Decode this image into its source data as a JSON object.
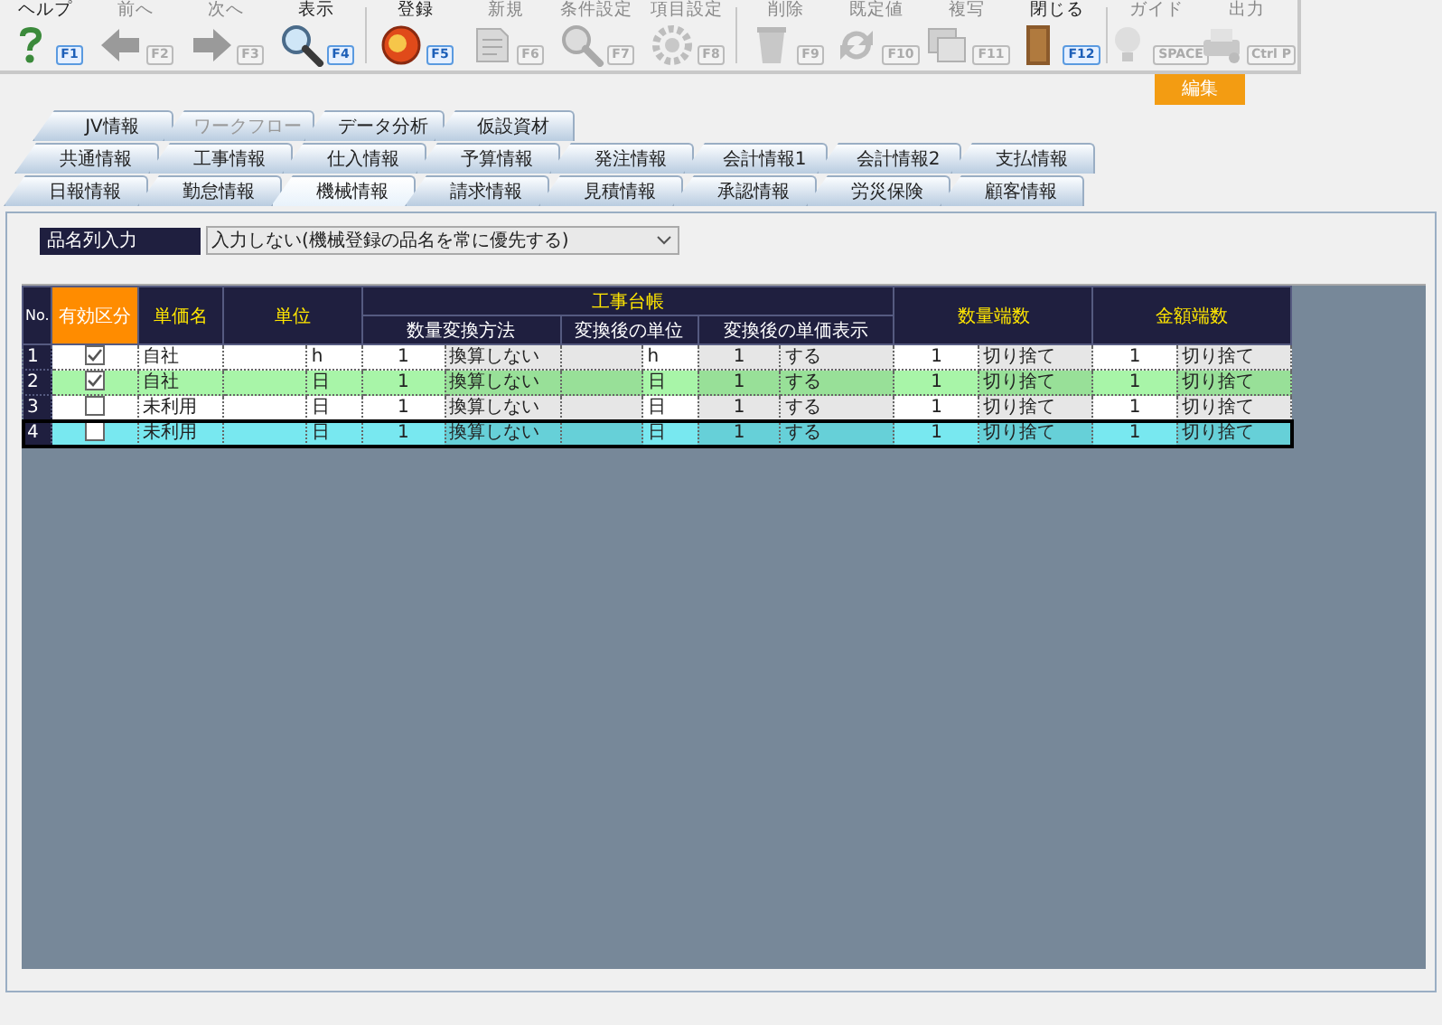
{
  "toolbar": {
    "groups": [
      [
        {
          "label": "ヘルプ",
          "key": "F1",
          "disabled": false
        },
        {
          "label": "前へ",
          "key": "F2",
          "disabled": true
        },
        {
          "label": "次へ",
          "key": "F3",
          "disabled": true
        },
        {
          "label": "表示",
          "key": "F4",
          "disabled": false
        }
      ],
      [
        {
          "label": "登録",
          "key": "F5",
          "disabled": false
        },
        {
          "label": "新規",
          "key": "F6",
          "disabled": true
        },
        {
          "label": "条件設定",
          "key": "F7",
          "disabled": true
        },
        {
          "label": "項目設定",
          "key": "F8",
          "disabled": true
        }
      ],
      [
        {
          "label": "削除",
          "key": "F9",
          "disabled": true
        },
        {
          "label": "既定値",
          "key": "F10",
          "disabled": true
        },
        {
          "label": "複写",
          "key": "F11",
          "disabled": true
        },
        {
          "label": "閉じる",
          "key": "F12",
          "disabled": false
        }
      ],
      [
        {
          "label": "ガイド",
          "key": "SPACE",
          "disabled": true
        },
        {
          "label": "出力",
          "key": "Ctrl P",
          "disabled": true
        }
      ]
    ]
  },
  "mode_badge": "編集",
  "tab_rows": [
    [
      {
        "label": "JV情報",
        "selected": false,
        "disabled": false
      },
      {
        "label": "ワークフロー",
        "selected": false,
        "disabled": true
      },
      {
        "label": "データ分析",
        "selected": false,
        "disabled": false
      },
      {
        "label": "仮設資材",
        "selected": false,
        "disabled": false
      }
    ],
    [
      {
        "label": "共通情報",
        "selected": false,
        "disabled": false
      },
      {
        "label": "工事情報",
        "selected": false,
        "disabled": false
      },
      {
        "label": "仕入情報",
        "selected": false,
        "disabled": false
      },
      {
        "label": "予算情報",
        "selected": false,
        "disabled": false
      },
      {
        "label": "発注情報",
        "selected": false,
        "disabled": false
      },
      {
        "label": "会計情報1",
        "selected": false,
        "disabled": false
      },
      {
        "label": "会計情報2",
        "selected": false,
        "disabled": false
      },
      {
        "label": "支払情報",
        "selected": false,
        "disabled": false
      }
    ],
    [
      {
        "label": "日報情報",
        "selected": false,
        "disabled": false
      },
      {
        "label": "勤怠情報",
        "selected": false,
        "disabled": false
      },
      {
        "label": "機械情報",
        "selected": true,
        "disabled": false
      },
      {
        "label": "請求情報",
        "selected": false,
        "disabled": false
      },
      {
        "label": "見積情報",
        "selected": false,
        "disabled": false
      },
      {
        "label": "承認情報",
        "selected": false,
        "disabled": false
      },
      {
        "label": "労災保険",
        "selected": false,
        "disabled": false
      },
      {
        "label": "顧客情報",
        "selected": false,
        "disabled": false
      }
    ]
  ],
  "item_name_input": {
    "label": "品名列入力",
    "value": "入力しない(機械登録の品名を常に優先する)"
  },
  "grid": {
    "headers": {
      "no": "No.",
      "valid": "有効区分",
      "price_name": "単価名",
      "unit": "単位",
      "group": "工事台帳",
      "qty_conv": "数量変換方法",
      "conv_unit": "変換後の単位",
      "conv_price": "変換後の単価表示",
      "qty_round": "数量端数",
      "amt_round": "金額端数"
    },
    "rows": [
      {
        "no": "1",
        "checked": true,
        "price_name": "自社",
        "unit": "h",
        "qty_conv_num": "1",
        "qty_conv": "換算しない",
        "conv_unit": "h",
        "conv_price_num": "1",
        "conv_price": "する",
        "qty_round_num": "1",
        "qty_round": "切り捨て",
        "amt_round_num": "1",
        "amt_round": "切り捨て",
        "highlighted": false,
        "selected": false
      },
      {
        "no": "2",
        "checked": true,
        "price_name": "自社",
        "unit": "日",
        "qty_conv_num": "1",
        "qty_conv": "換算しない",
        "conv_unit": "日",
        "conv_price_num": "1",
        "conv_price": "する",
        "qty_round_num": "1",
        "qty_round": "切り捨て",
        "amt_round_num": "1",
        "amt_round": "切り捨て",
        "highlighted": true,
        "selected": false
      },
      {
        "no": "3",
        "checked": false,
        "price_name": "未利用",
        "unit": "日",
        "qty_conv_num": "1",
        "qty_conv": "換算しない",
        "conv_unit": "日",
        "conv_price_num": "1",
        "conv_price": "する",
        "qty_round_num": "1",
        "qty_round": "切り捨て",
        "amt_round_num": "1",
        "amt_round": "切り捨て",
        "highlighted": false,
        "selected": false
      },
      {
        "no": "4",
        "checked": false,
        "price_name": "未利用",
        "unit": "日",
        "qty_conv_num": "1",
        "qty_conv": "換算しない",
        "conv_unit": "日",
        "conv_price_num": "1",
        "conv_price": "する",
        "qty_round_num": "1",
        "qty_round": "切り捨て",
        "amt_round_num": "1",
        "amt_round": "切り捨て",
        "highlighted": false,
        "selected": true
      }
    ]
  }
}
